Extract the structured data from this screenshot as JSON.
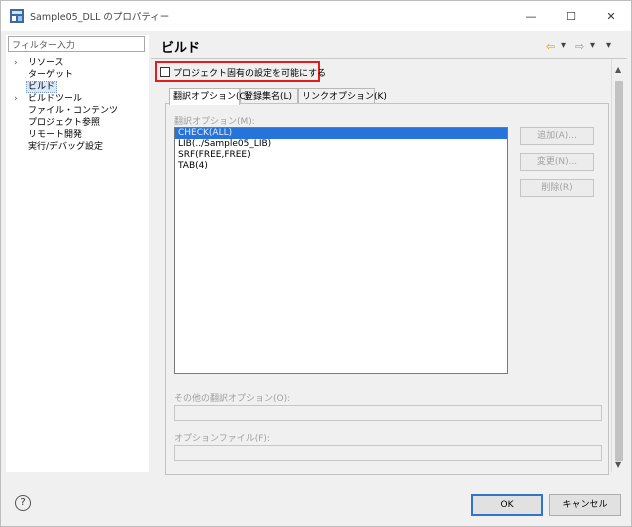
{
  "window": {
    "title": "Sample05_DLL のプロパティー",
    "min_glyph": "—",
    "max_glyph": "☐",
    "close_glyph": "✕"
  },
  "sidebar": {
    "filter_placeholder": "フィルター入力",
    "items": [
      {
        "label": "リソース",
        "expandable": true,
        "arrow": "›"
      },
      {
        "label": "ターゲット",
        "expandable": false
      },
      {
        "label": "ビルド",
        "expandable": false,
        "selected": true
      },
      {
        "label": "ビルドツール",
        "expandable": true,
        "arrow": "›"
      },
      {
        "label": "ファイル・コンテンツ",
        "expandable": false
      },
      {
        "label": "プロジェクト参照",
        "expandable": false
      },
      {
        "label": "リモート開発",
        "expandable": false
      },
      {
        "label": "実行/デバッグ設定",
        "expandable": false
      }
    ]
  },
  "page": {
    "title": "ビルド",
    "nav": {
      "back": "⇦",
      "back_menu": "▾",
      "forward": "⇨",
      "forward_menu": "▾",
      "menu": "▾"
    },
    "project_specific_checkbox": {
      "label": "プロジェクト固有の設定を可能にする",
      "checked": false
    },
    "tabs": [
      {
        "label": "翻訳オプション(C)",
        "active": true
      },
      {
        "label": "登録集名(L)",
        "active": false
      },
      {
        "label": "リンクオプション(K)",
        "active": false
      }
    ],
    "translate_options_label": "翻訳オプション(M):",
    "translate_options": [
      {
        "value": "CHECK(ALL)",
        "selected": true
      },
      {
        "value": "LIB(../Sample05_LIB)",
        "selected": false
      },
      {
        "value": "SRF(FREE,FREE)",
        "selected": false
      },
      {
        "value": "TAB(4)",
        "selected": false
      }
    ],
    "buttons": {
      "add": "追加(A)...",
      "change": "変更(N)...",
      "delete": "削除(R)"
    },
    "other_options_label": "その他の翻訳オプション(O):",
    "other_options_value": "",
    "option_file_label": "オプションファイル(F):",
    "option_file_value": ""
  },
  "scrollbar": {
    "up": "▲",
    "down": "▼"
  },
  "footer": {
    "help": "?",
    "ok": "OK",
    "cancel": "キャンセル"
  },
  "colors": {
    "highlight_box": "#e21d1d",
    "selection": "#2673d9",
    "ok_border": "#2f75c9"
  }
}
